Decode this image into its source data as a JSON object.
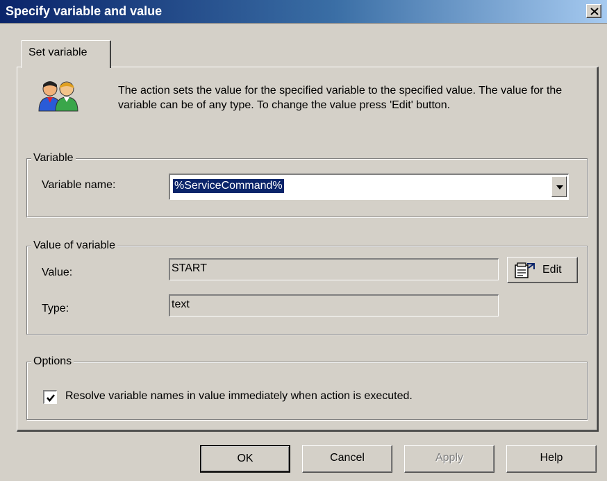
{
  "window": {
    "title": "Specify variable and value"
  },
  "tabs": [
    {
      "label": "Set variable",
      "active": true
    }
  ],
  "description": "The action sets the value for the specified variable to the specified value. The value for the variable can be of any type. To change the value press 'Edit' button.",
  "variable_group": {
    "label": "Variable",
    "name_label": "Variable name:",
    "name_value": "%ServiceCommand%"
  },
  "value_group": {
    "label": "Value of variable",
    "value_label": "Value:",
    "value": "START",
    "type_label": "Type:",
    "type": "text",
    "edit_button": "Edit"
  },
  "options_group": {
    "label": "Options",
    "resolve_checkbox_label": "Resolve variable names in value immediately when action is executed.",
    "resolve_checked": true
  },
  "buttons": {
    "ok": "OK",
    "cancel": "Cancel",
    "apply": "Apply",
    "help": "Help"
  },
  "colors": {
    "face": "#d4d0c8",
    "title_start": "#0a246a",
    "title_end": "#a6caf0",
    "selection": "#0a246a"
  },
  "icons": {
    "close": "close-icon",
    "users": "users-icon",
    "dropdown": "chevron-down-icon",
    "edit": "edit-properties-icon",
    "check": "checkmark-icon"
  }
}
